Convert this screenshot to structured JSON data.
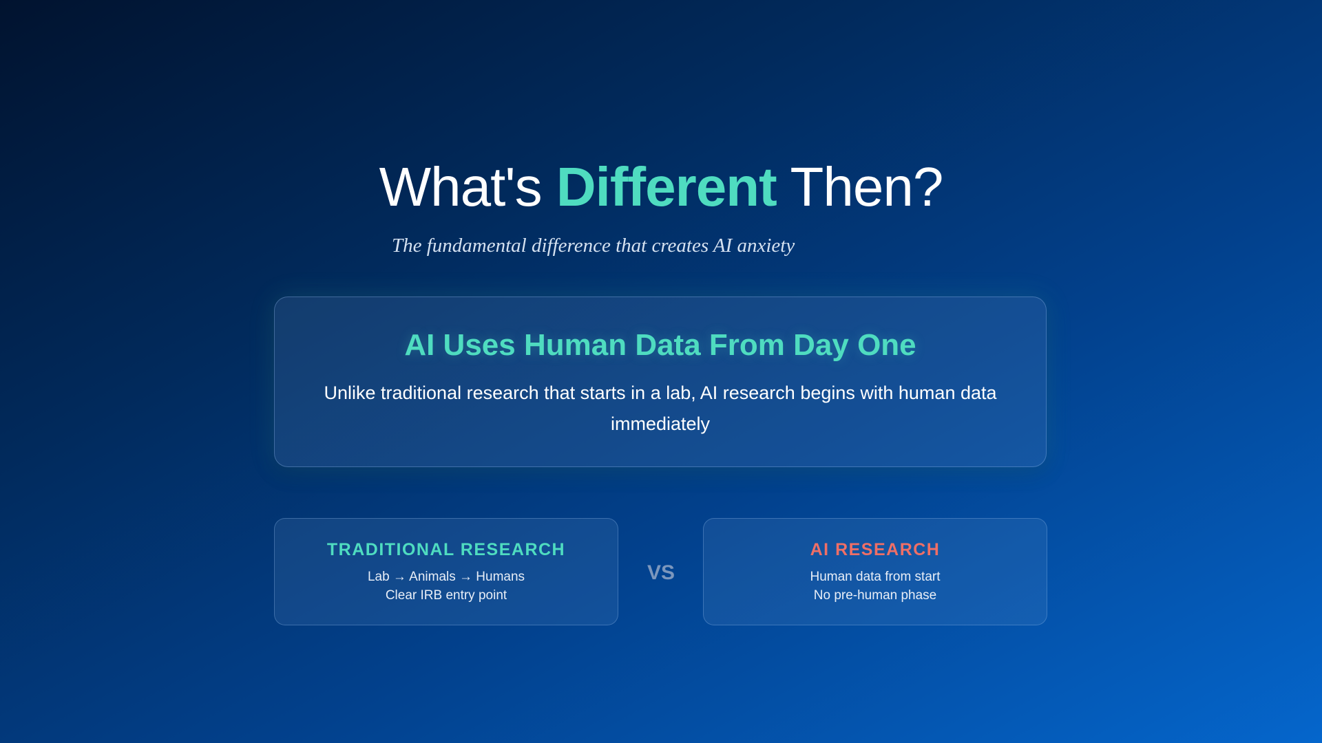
{
  "slide": {
    "title_pre": "What's ",
    "title_accent": "Different",
    "title_post": " Then?",
    "subtitle": "The fundamental difference that creates AI anxiety"
  },
  "hero": {
    "heading": "AI Uses Human Data From Day One",
    "body": "Unlike traditional research that starts in a lab, AI research begins with human data immediately"
  },
  "comparison": {
    "left": {
      "title": "TRADITIONAL RESEARCH",
      "line1": "Lab → Animals → Humans",
      "line2": "Clear IRB entry point"
    },
    "separator": "VS",
    "right": {
      "title": "AI RESEARCH",
      "line1": "Human data from start",
      "line2": "No pre-human phase"
    }
  },
  "colors": {
    "accent": "#4fdcc0",
    "warning": "#ef6f66",
    "background_start": "#01132f",
    "background_end": "#0566cc"
  }
}
